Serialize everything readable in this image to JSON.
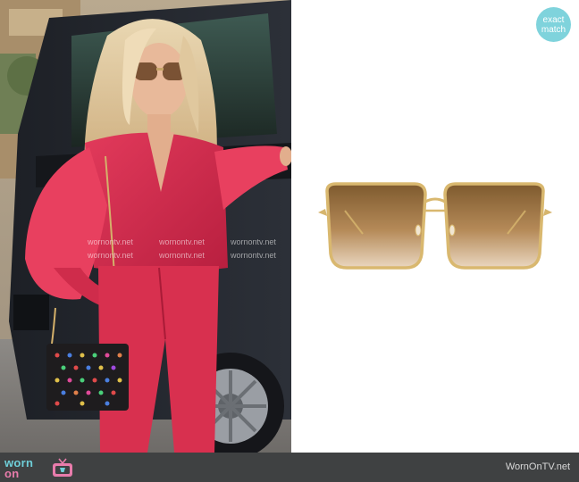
{
  "badge": {
    "line1": "exact",
    "line2": "match"
  },
  "watermark": {
    "text": "wornontv.net"
  },
  "footer": {
    "logo_word_1": "worn",
    "logo_word_2": "on",
    "site_name": "WornOnTV.net"
  },
  "colors": {
    "badge_bg": "#7fd3dc",
    "footer_bg": "#3f4142",
    "logo_teal": "#6fcfd9",
    "logo_pink": "#e87cab"
  }
}
